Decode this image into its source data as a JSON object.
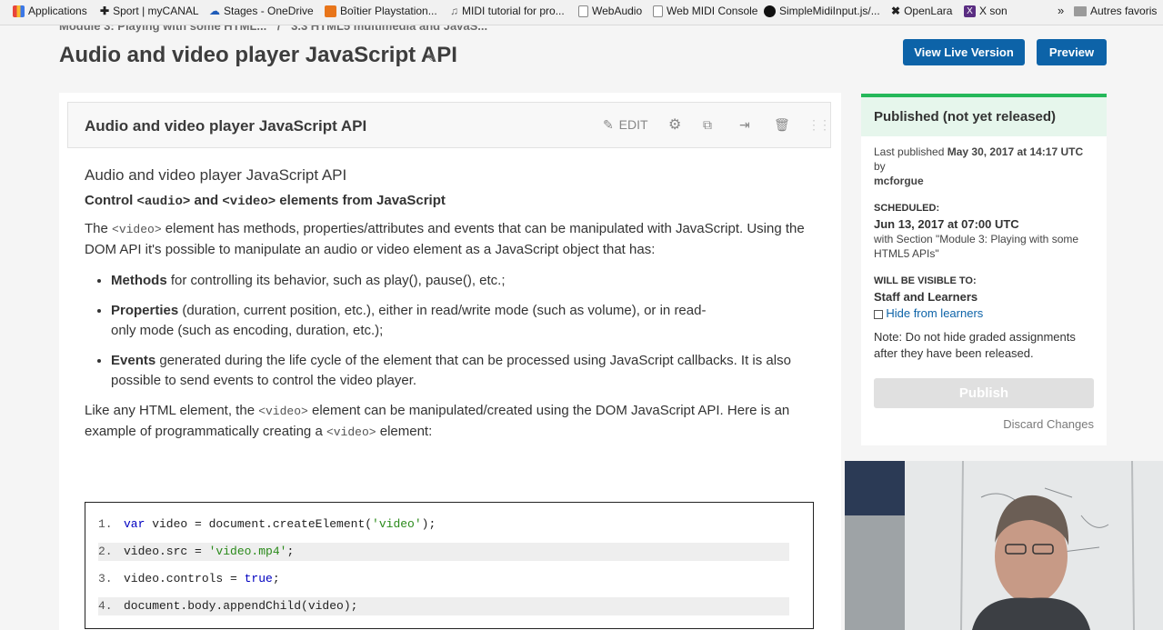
{
  "bookmarks": [
    {
      "label": "Applications",
      "icon": "apps-grid-icon",
      "color": "#e8453c"
    },
    {
      "label": "Sport | myCANAL",
      "icon": "plus-icon",
      "color": "#111111"
    },
    {
      "label": "Stages - OneDrive",
      "icon": "cloud-icon",
      "color": "#1e5bb8"
    },
    {
      "label": "Boîtier Playstation...",
      "icon": "store-icon",
      "color": "#e8751a"
    },
    {
      "label": "MIDI tutorial for pro...",
      "icon": "piano-icon",
      "color": "#666666"
    },
    {
      "label": "WebAudio",
      "icon": "page-icon",
      "color": "#777777"
    },
    {
      "label": "Web MIDI Console",
      "icon": "page-icon",
      "color": "#777777"
    },
    {
      "label": "SimpleMidiInput.js/...",
      "icon": "github-icon",
      "color": "#111111"
    },
    {
      "label": "OpenLara",
      "icon": "lara-icon",
      "color": "#222222"
    },
    {
      "label": "X son",
      "icon": "x-icon",
      "color": "#5a2d82"
    }
  ],
  "bookmarks_more": "»",
  "bookmarks_folder": "Autres favoris",
  "breadcrumb": {
    "section": "Module 3: Playing with some HTML...",
    "separator": "/",
    "subsection": "3.3 HTML5 multimedia and JavaS..."
  },
  "page_title": "Audio and video player JavaScript API",
  "header_buttons": {
    "live": "View Live Version",
    "preview": "Preview"
  },
  "unit": {
    "title": "Audio and video player JavaScript API",
    "edit_label": "EDIT"
  },
  "content": {
    "heading": "Audio and video player JavaScript API",
    "subheading_pre": "Control ",
    "subheading_code1": "<audio>",
    "subheading_mid": " and ",
    "subheading_code2": "<video>",
    "subheading_post": " elements from JavaScript",
    "p1_pre": "The ",
    "p1_code": "<video>",
    "p1_post": " element has methods, properties/attributes and events that can be manipulated with JavaScript. Using the DOM API it's possible to manipulate an audio or video element as a JavaScript object that has:",
    "bullets": [
      {
        "bold": "Methods",
        "text": " for controlling its behavior, such as play(), pause(), etc.;"
      },
      {
        "bold": "Properties",
        "text": " (duration, current position, etc.), either in read/write mode (such as volume), or in read-only mode (such as encoding, duration, etc.);"
      },
      {
        "bold": "Events",
        "text": " generated during the life cycle of the element that can be processed using JavaScript callbacks. It is also possible to send events to control the video player."
      }
    ],
    "p2_pre": "Like any HTML element, the ",
    "p2_code": "<video>",
    "p2_mid": " element can be manipulated/created using the DOM JavaScript API. Here is an example of programmatically creating a ",
    "p2_code2": "<video>",
    "p2_post": " element:"
  },
  "code_lines": [
    {
      "n": "1.",
      "a": "var",
      "b": " video = document.createElement(",
      "c": "'video'",
      "d": ");"
    },
    {
      "n": "2.",
      "a": "",
      "b": "video.src = ",
      "c": "'video.mp4'",
      "d": ";"
    },
    {
      "n": "3.",
      "a": "",
      "b": "video.controls = ",
      "c": "true",
      "d": ";"
    },
    {
      "n": "4.",
      "a": "",
      "b": "document.body.appendChild(video);",
      "c": "",
      "d": ""
    }
  ],
  "sidebar": {
    "status": "Published (not yet released)",
    "last_published_pre": "Last published ",
    "last_published_date": "May 30, 2017 at 14:17 UTC",
    "last_published_by": " by",
    "last_published_user": "mcforgue",
    "scheduled_label": "SCHEDULED:",
    "scheduled_date": "Jun 13, 2017 at 07:00 UTC",
    "scheduled_note": "with Section \"Module 3: Playing with some HTML5 APIs\"",
    "visible_label": "WILL BE VISIBLE TO:",
    "visible_value": "Staff and Learners",
    "hide_link": "Hide from learners",
    "note": "Note: Do not hide graded assignments after they have been released.",
    "publish": "Publish",
    "discard": "Discard Changes",
    "accent": "#25b85a"
  }
}
